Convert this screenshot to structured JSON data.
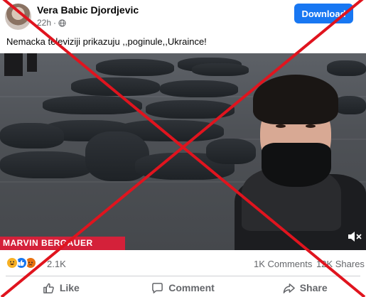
{
  "post": {
    "author": "Vera Babic Djordjevic",
    "time": "22h",
    "visibility_icon": "globe-icon",
    "download_label": "Download",
    "caption": "Nemacka televiziji prikazuju  ,,poginule,,Ukraince!"
  },
  "video": {
    "lower_third": "MARVIN BERGAUER",
    "volume_icon": "speaker-muted-icon"
  },
  "stats": {
    "reactions": [
      "haha-icon",
      "like-icon",
      "angry-icon"
    ],
    "reaction_count": "2.1K",
    "comments": "1K Comments",
    "shares": "12K Shares"
  },
  "actions": {
    "like": "Like",
    "comment": "Comment",
    "share": "Share"
  },
  "colors": {
    "brand_blue": "#1877f2",
    "overlay_red": "#e0141e",
    "lower_third_red": "#d4213a"
  }
}
